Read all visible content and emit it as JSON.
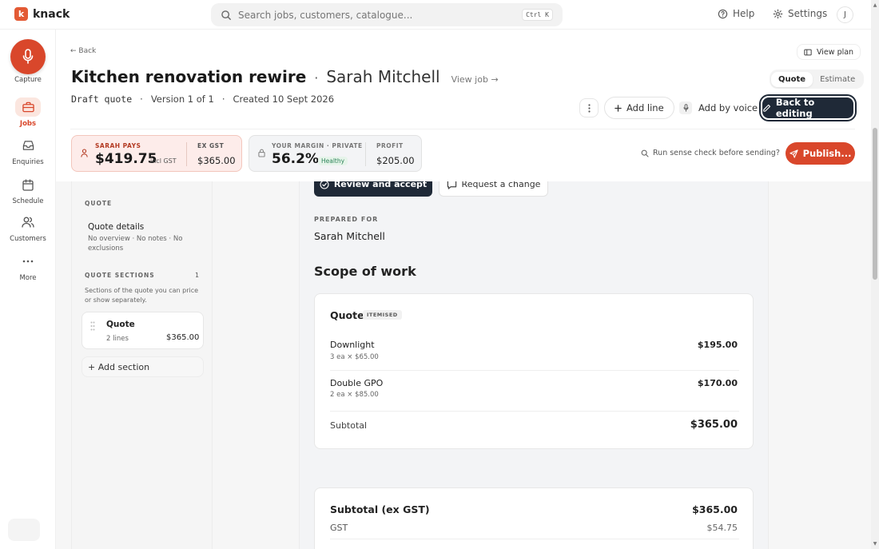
{
  "app": {
    "logo_letter": "k",
    "name": "knack",
    "accent": "#d9472b"
  },
  "search": {
    "placeholder": "Search jobs, customers, catalogue...",
    "shortcut": "Ctrl K"
  },
  "topnav": {
    "help": "Help",
    "settings": "Settings",
    "avatar_initial": "J"
  },
  "leftnav": {
    "capture": "Capture",
    "items": [
      {
        "label": "Jobs",
        "icon": "briefcase-icon",
        "active": true
      },
      {
        "label": "Enquiries",
        "icon": "inbox-icon",
        "active": false
      },
      {
        "label": "Schedule",
        "icon": "calendar-icon",
        "active": false
      },
      {
        "label": "Customers",
        "icon": "users-icon",
        "active": false
      },
      {
        "label": "More",
        "icon": "more-icon",
        "active": false
      }
    ]
  },
  "header": {
    "back": "← Back",
    "view_plan": "View plan",
    "title": "Kitchen renovation rewire",
    "separator": "·",
    "customer": "Sarah Mitchell",
    "view_job": "View job →",
    "status": "Draft quote",
    "version": "Version 1 of 1",
    "created": "Created 10 Sept 2026",
    "tabs": {
      "quote": "Quote",
      "estimate": "Estimate"
    },
    "add_line": "Add line",
    "add_by_voice": "Add by voice",
    "back_to_editing": "Back to editing"
  },
  "summary": {
    "pays_label": "SARAH PAYS",
    "pays_amount": "$419.75",
    "pays_suffix": "incl GST",
    "ex_gst_label": "EX GST",
    "ex_gst_amount": "$365.00",
    "margin_label": "YOUR MARGIN · PRIVATE",
    "margin_value": "56.2%",
    "margin_status": "Healthy",
    "profit_label": "PROFIT",
    "profit_amount": "$205.00",
    "sense_check": "Run sense check before sending?",
    "publish": "Publish..."
  },
  "sidebar": {
    "quote_heading": "QUOTE",
    "details_title": "Quote details",
    "details_sub": "No overview · No notes · No exclusions",
    "sections_heading": "QUOTE SECTIONS",
    "sections_count": "1",
    "sections_desc": "Sections of the quote you can price or show separately.",
    "section": {
      "name": "Quote",
      "lines": "2 lines",
      "amount": "$365.00"
    },
    "add_section": "+ Add section"
  },
  "document": {
    "review_accept": "Review and accept",
    "request_change": "Request a change",
    "prepared_for_label": "PREPARED FOR",
    "prepared_for": "Sarah Mitchell",
    "scope_title": "Scope of work",
    "section_title": "Quote",
    "section_badge": "ITEMISED",
    "line_items": [
      {
        "name": "Downlight",
        "detail": "3 ea × $65.00",
        "amount": "$195.00"
      },
      {
        "name": "Double GPO",
        "detail": "2 ea × $85.00",
        "amount": "$170.00"
      }
    ],
    "subtotal_label": "Subtotal",
    "subtotal_amount": "$365.00",
    "totals": {
      "subtotal_ex_gst_label": "Subtotal (ex GST)",
      "subtotal_ex_gst_amount": "$365.00",
      "gst_label": "GST",
      "gst_amount": "$54.75"
    }
  }
}
